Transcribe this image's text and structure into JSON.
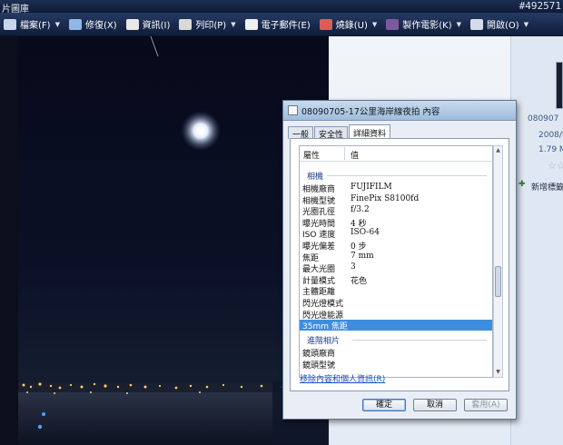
{
  "window": {
    "title": "片圖庫",
    "code": "#492571"
  },
  "toolbar": {
    "items": [
      {
        "label": "檔案(F)",
        "icon": "file-icon",
        "color": "#c7d6ee"
      },
      {
        "label": "修復(X)",
        "icon": "fix-icon",
        "color": "#8fb7e8"
      },
      {
        "label": "資訊(I)",
        "icon": "info-icon",
        "color": "#e8e8e8"
      },
      {
        "label": "列印(P)",
        "icon": "printer-icon",
        "color": "#d9d9d9"
      },
      {
        "label": "電子郵件(E)",
        "icon": "email-icon",
        "color": "#f0f0f0"
      },
      {
        "label": "燒錄(U)",
        "icon": "burn-disc-icon",
        "color": "#e05a5a"
      },
      {
        "label": "製作電影(K)",
        "icon": "movie-icon",
        "color": "#7a5a9a"
      },
      {
        "label": "開啟(O)",
        "icon": "open-folder-icon",
        "color": "#d3dde9"
      }
    ]
  },
  "gallery": {
    "filename_partial": "080907",
    "date_partial": "2008/9,",
    "size_partial": "1.79 MB",
    "tag_partial": "新增標籤"
  },
  "dialog": {
    "title": "08090705-17公里海岸線夜拍 內容",
    "tabs": [
      "一般",
      "安全性",
      "詳細資料"
    ],
    "header": {
      "property": "屬性",
      "value": "值"
    },
    "groups": [
      "相機",
      "進階相片"
    ],
    "rows": [
      {
        "k": "相機廠商",
        "v": "FUJIFILM"
      },
      {
        "k": "相機型號",
        "v": "FinePix S8100fd"
      },
      {
        "k": "光圈孔徑",
        "v": "f/3.2"
      },
      {
        "k": "曝光時間",
        "v": "4 秒"
      },
      {
        "k": "ISO 速度",
        "v": "ISO-64"
      },
      {
        "k": "曝光偏差",
        "v": "0 步"
      },
      {
        "k": "焦距",
        "v": "7 mm"
      },
      {
        "k": "最大光圈",
        "v": "3"
      },
      {
        "k": "計量模式",
        "v": "花色"
      },
      {
        "k": "主體距離",
        "v": ""
      },
      {
        "k": "閃光燈模式",
        "v": ""
      },
      {
        "k": "閃光燈能源",
        "v": ""
      },
      {
        "k": "35mm 焦距",
        "v": ""
      }
    ],
    "adv_rows": [
      {
        "k": "鏡頭廠商",
        "v": ""
      },
      {
        "k": "鏡頭型號",
        "v": ""
      }
    ],
    "selected_index": 12,
    "link": "移除內容和個人資訊(R)",
    "buttons": {
      "ok": "確定",
      "cancel": "取消",
      "apply": "套用(A)"
    }
  }
}
